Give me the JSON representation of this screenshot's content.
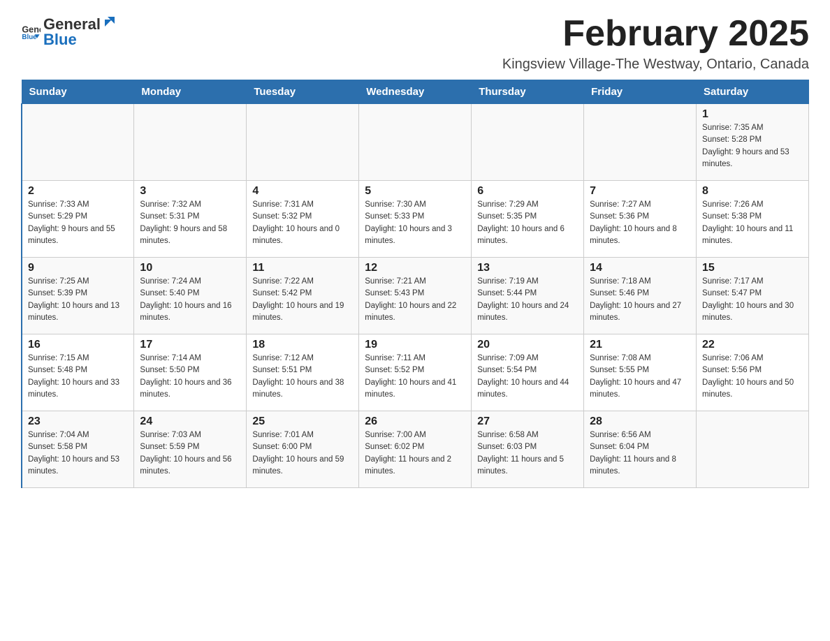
{
  "logo": {
    "text_general": "General",
    "text_blue": "Blue"
  },
  "title": "February 2025",
  "location": "Kingsview Village-The Westway, Ontario, Canada",
  "days_of_week": [
    "Sunday",
    "Monday",
    "Tuesday",
    "Wednesday",
    "Thursday",
    "Friday",
    "Saturday"
  ],
  "weeks": [
    [
      {
        "day": "",
        "info": ""
      },
      {
        "day": "",
        "info": ""
      },
      {
        "day": "",
        "info": ""
      },
      {
        "day": "",
        "info": ""
      },
      {
        "day": "",
        "info": ""
      },
      {
        "day": "",
        "info": ""
      },
      {
        "day": "1",
        "info": "Sunrise: 7:35 AM\nSunset: 5:28 PM\nDaylight: 9 hours and 53 minutes."
      }
    ],
    [
      {
        "day": "2",
        "info": "Sunrise: 7:33 AM\nSunset: 5:29 PM\nDaylight: 9 hours and 55 minutes."
      },
      {
        "day": "3",
        "info": "Sunrise: 7:32 AM\nSunset: 5:31 PM\nDaylight: 9 hours and 58 minutes."
      },
      {
        "day": "4",
        "info": "Sunrise: 7:31 AM\nSunset: 5:32 PM\nDaylight: 10 hours and 0 minutes."
      },
      {
        "day": "5",
        "info": "Sunrise: 7:30 AM\nSunset: 5:33 PM\nDaylight: 10 hours and 3 minutes."
      },
      {
        "day": "6",
        "info": "Sunrise: 7:29 AM\nSunset: 5:35 PM\nDaylight: 10 hours and 6 minutes."
      },
      {
        "day": "7",
        "info": "Sunrise: 7:27 AM\nSunset: 5:36 PM\nDaylight: 10 hours and 8 minutes."
      },
      {
        "day": "8",
        "info": "Sunrise: 7:26 AM\nSunset: 5:38 PM\nDaylight: 10 hours and 11 minutes."
      }
    ],
    [
      {
        "day": "9",
        "info": "Sunrise: 7:25 AM\nSunset: 5:39 PM\nDaylight: 10 hours and 13 minutes."
      },
      {
        "day": "10",
        "info": "Sunrise: 7:24 AM\nSunset: 5:40 PM\nDaylight: 10 hours and 16 minutes."
      },
      {
        "day": "11",
        "info": "Sunrise: 7:22 AM\nSunset: 5:42 PM\nDaylight: 10 hours and 19 minutes."
      },
      {
        "day": "12",
        "info": "Sunrise: 7:21 AM\nSunset: 5:43 PM\nDaylight: 10 hours and 22 minutes."
      },
      {
        "day": "13",
        "info": "Sunrise: 7:19 AM\nSunset: 5:44 PM\nDaylight: 10 hours and 24 minutes."
      },
      {
        "day": "14",
        "info": "Sunrise: 7:18 AM\nSunset: 5:46 PM\nDaylight: 10 hours and 27 minutes."
      },
      {
        "day": "15",
        "info": "Sunrise: 7:17 AM\nSunset: 5:47 PM\nDaylight: 10 hours and 30 minutes."
      }
    ],
    [
      {
        "day": "16",
        "info": "Sunrise: 7:15 AM\nSunset: 5:48 PM\nDaylight: 10 hours and 33 minutes."
      },
      {
        "day": "17",
        "info": "Sunrise: 7:14 AM\nSunset: 5:50 PM\nDaylight: 10 hours and 36 minutes."
      },
      {
        "day": "18",
        "info": "Sunrise: 7:12 AM\nSunset: 5:51 PM\nDaylight: 10 hours and 38 minutes."
      },
      {
        "day": "19",
        "info": "Sunrise: 7:11 AM\nSunset: 5:52 PM\nDaylight: 10 hours and 41 minutes."
      },
      {
        "day": "20",
        "info": "Sunrise: 7:09 AM\nSunset: 5:54 PM\nDaylight: 10 hours and 44 minutes."
      },
      {
        "day": "21",
        "info": "Sunrise: 7:08 AM\nSunset: 5:55 PM\nDaylight: 10 hours and 47 minutes."
      },
      {
        "day": "22",
        "info": "Sunrise: 7:06 AM\nSunset: 5:56 PM\nDaylight: 10 hours and 50 minutes."
      }
    ],
    [
      {
        "day": "23",
        "info": "Sunrise: 7:04 AM\nSunset: 5:58 PM\nDaylight: 10 hours and 53 minutes."
      },
      {
        "day": "24",
        "info": "Sunrise: 7:03 AM\nSunset: 5:59 PM\nDaylight: 10 hours and 56 minutes."
      },
      {
        "day": "25",
        "info": "Sunrise: 7:01 AM\nSunset: 6:00 PM\nDaylight: 10 hours and 59 minutes."
      },
      {
        "day": "26",
        "info": "Sunrise: 7:00 AM\nSunset: 6:02 PM\nDaylight: 11 hours and 2 minutes."
      },
      {
        "day": "27",
        "info": "Sunrise: 6:58 AM\nSunset: 6:03 PM\nDaylight: 11 hours and 5 minutes."
      },
      {
        "day": "28",
        "info": "Sunrise: 6:56 AM\nSunset: 6:04 PM\nDaylight: 11 hours and 8 minutes."
      },
      {
        "day": "",
        "info": ""
      }
    ]
  ]
}
